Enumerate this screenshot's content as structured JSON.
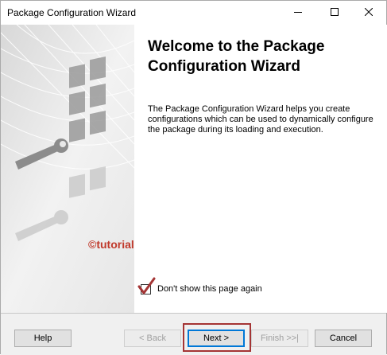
{
  "window": {
    "title": "Package Configuration Wizard"
  },
  "titlebar_icons": {
    "minimize": "minimize-icon",
    "maximize": "maximize-icon",
    "close": "close-icon"
  },
  "content": {
    "heading": "Welcome to the Package Configuration Wizard",
    "description": "The Package Configuration Wizard helps you create configurations which can be used to dynamically configure the package during its loading and execution.",
    "watermark": "©tutorialgateway.org"
  },
  "options": {
    "dont_show_label": "Don't show this page again",
    "dont_show_checked": true
  },
  "buttons": {
    "help": "Help",
    "back": "< Back",
    "next": "Next >",
    "finish": "Finish >>|",
    "cancel": "Cancel"
  },
  "colors": {
    "annotation_red": "#a43434",
    "focus_blue": "#0078d7"
  }
}
